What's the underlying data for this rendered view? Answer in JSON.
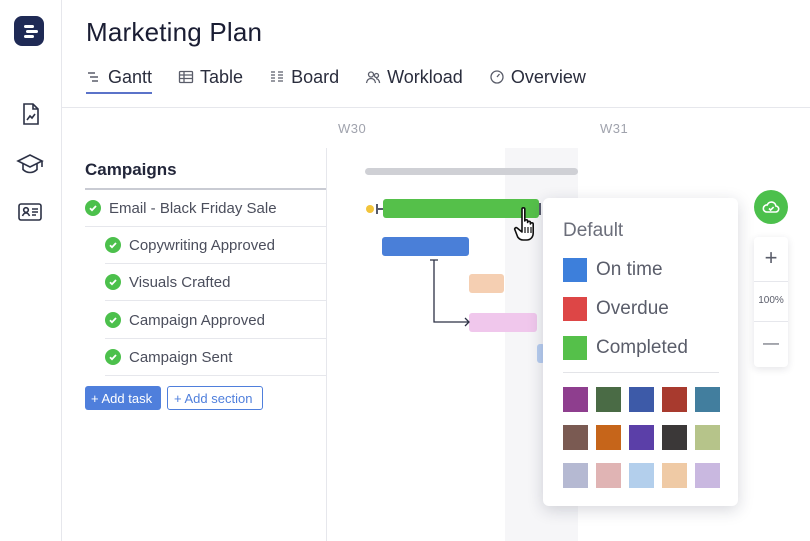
{
  "app": {
    "title": "Marketing Plan"
  },
  "tabs": [
    {
      "label": "Gantt",
      "icon": "gantt-icon",
      "active": true
    },
    {
      "label": "Table",
      "icon": "table-icon"
    },
    {
      "label": "Board",
      "icon": "board-icon"
    },
    {
      "label": "Workload",
      "icon": "workload-icon"
    },
    {
      "label": "Overview",
      "icon": "overview-icon"
    }
  ],
  "rail_icons": [
    "logo-icon",
    "document-icon",
    "graduation-cap-icon",
    "contact-card-icon"
  ],
  "timeline": {
    "weeks": [
      "W30",
      "W31"
    ]
  },
  "list": {
    "section_title": "Campaigns",
    "tasks": [
      {
        "name": "Email - Black Friday Sale",
        "status": "completed"
      },
      {
        "name": "Copywriting Approved",
        "status": "completed"
      },
      {
        "name": "Visuals Crafted",
        "status": "completed"
      },
      {
        "name": "Campaign Approved",
        "status": "completed"
      },
      {
        "name": "Campaign Sent",
        "status": "completed"
      }
    ],
    "add_task_label": "+ Add task",
    "add_section_label": "+ Add section"
  },
  "color_menu": {
    "title": "Default",
    "legend": [
      {
        "label": "On time",
        "color": "#3d7fdb"
      },
      {
        "label": "Overdue",
        "color": "#dd4646"
      },
      {
        "label": "Completed",
        "color": "#55c04a"
      }
    ],
    "palette": [
      "#8e3e8e",
      "#4a6b45",
      "#3d5aa8",
      "#a83a2e",
      "#427e9e",
      "#7a5a52",
      "#c6651a",
      "#5b3fa8",
      "#3b3838",
      "#b6c48a",
      "#b5b9d2",
      "#e0b4b4",
      "#b3cfec",
      "#efcaa5",
      "#c9b8e0"
    ]
  },
  "zoom": {
    "level": "100%",
    "in_label": "+",
    "out_label": "—"
  },
  "colors": {
    "accent": "#4f7fdc",
    "green": "#4cc04c",
    "bar_blue": "#4a7fd8",
    "bar_peach": "#f5cfb2",
    "bar_lilac": "#f0c7ec",
    "brand_dark": "#1f2a55"
  }
}
